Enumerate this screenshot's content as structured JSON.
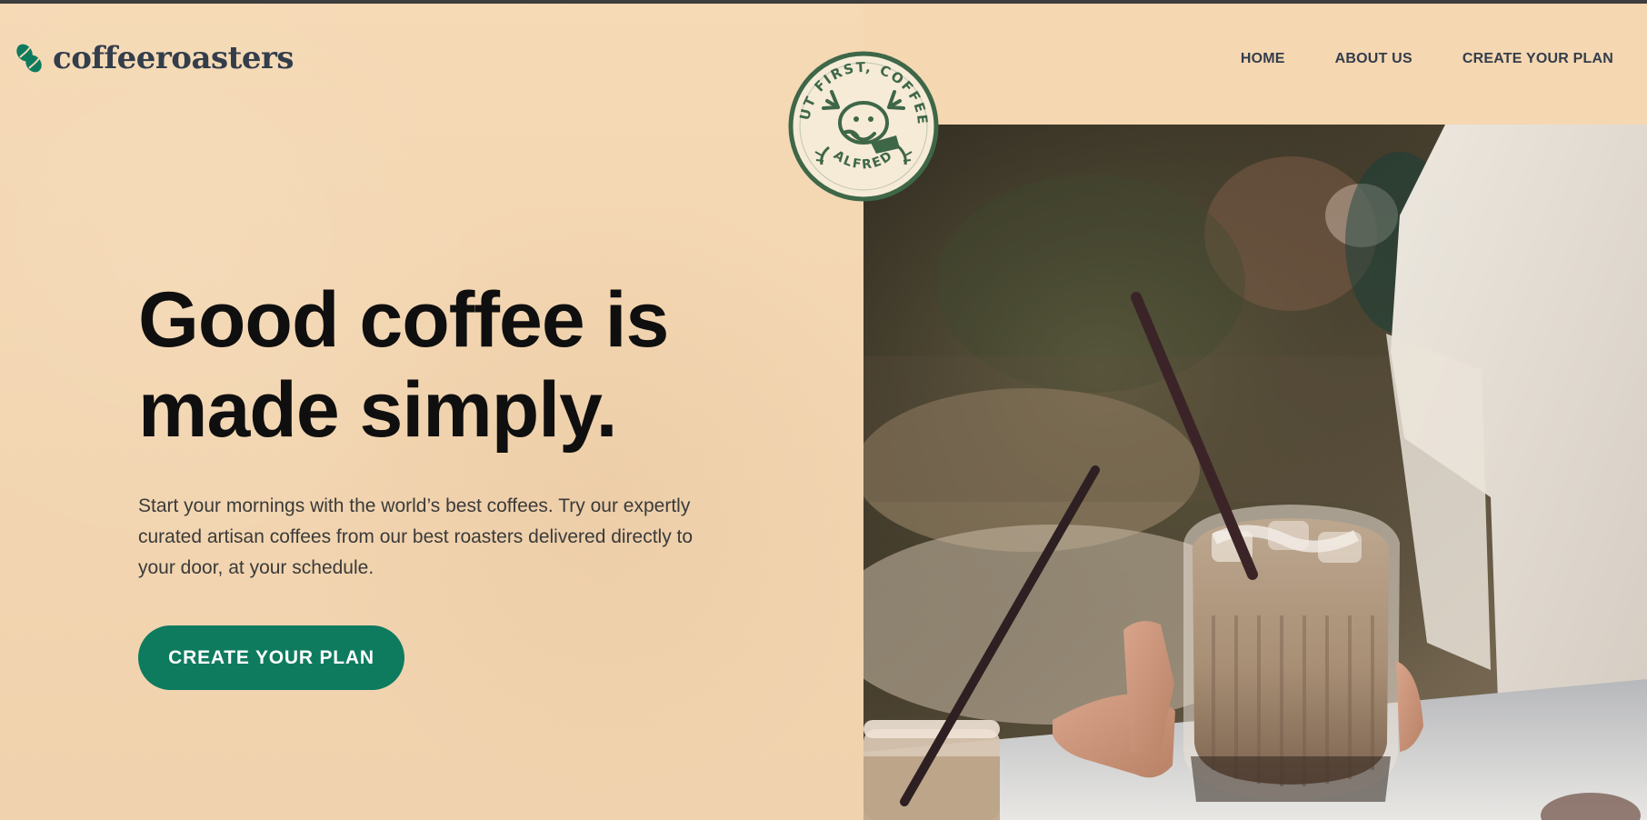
{
  "brand": {
    "logo_text": "coffeeroasters",
    "logo_icon": "coffee-bean-icon",
    "accent_color": "#0e7b5f",
    "background_color": "#f5d7b1",
    "text_color": "#333d4b"
  },
  "nav": {
    "items": [
      {
        "label": "HOME"
      },
      {
        "label": "ABOUT US"
      },
      {
        "label": "CREATE YOUR PLAN"
      }
    ]
  },
  "hero": {
    "headline_line1": "Good coffee is",
    "headline_line2": "made simply.",
    "description": "Start your mornings with the world’s best coffees. Try our expertly curated artisan coffees from our best roasters delivered directly to your door, at your schedule.",
    "cta_label": "CREATE YOUR PLAN"
  },
  "badge": {
    "text_top": "BUT FIRST, COFFEE.",
    "text_bottom": "ALFRED",
    "icon": "elk-mascot-icon"
  }
}
